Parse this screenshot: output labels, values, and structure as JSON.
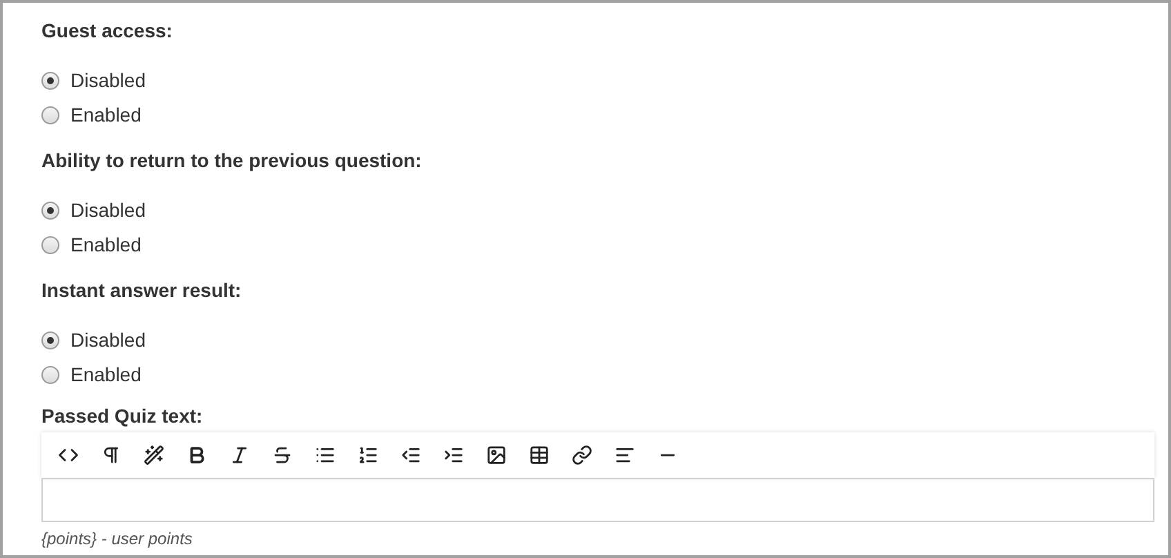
{
  "settings": [
    {
      "label": "Guest access:",
      "options": [
        {
          "label": "Disabled",
          "selected": true
        },
        {
          "label": "Enabled",
          "selected": false
        }
      ]
    },
    {
      "label": "Ability to return to the previous question:",
      "options": [
        {
          "label": "Disabled",
          "selected": true
        },
        {
          "label": "Enabled",
          "selected": false
        }
      ]
    },
    {
      "label": "Instant answer result:",
      "options": [
        {
          "label": "Disabled",
          "selected": true
        },
        {
          "label": "Enabled",
          "selected": false
        }
      ]
    }
  ],
  "editor": {
    "label": "Passed Quiz text:",
    "hint": "{points} - user points"
  }
}
